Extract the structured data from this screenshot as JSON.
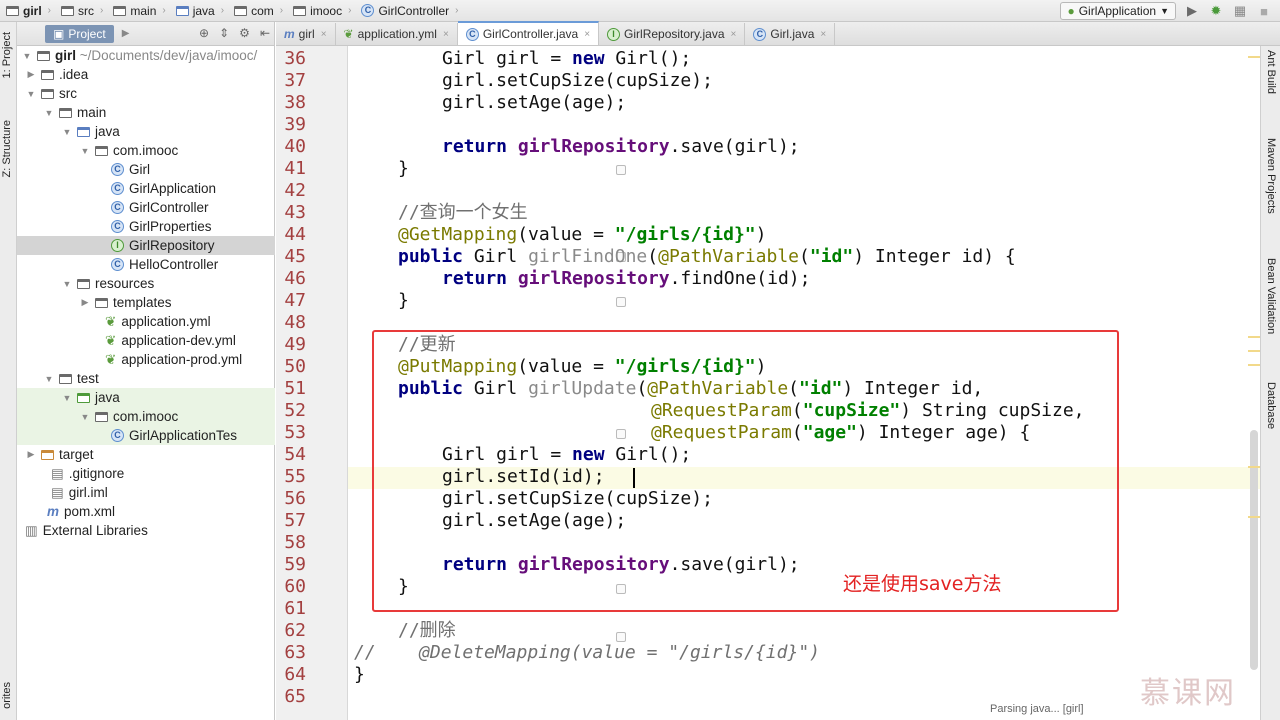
{
  "breadcrumb": [
    "girl",
    "src",
    "main",
    "java",
    "com",
    "imooc",
    "GirlController"
  ],
  "run_config": "GirlApplication",
  "left_tabs": [
    "1: Project",
    "Z: Structure",
    "orites"
  ],
  "right_tabs": [
    "Ant Build",
    "Maven Projects",
    "Bean Validation",
    "Database"
  ],
  "project_panel": {
    "title": "Project",
    "root_label": "girl",
    "root_path": "~/Documents/dev/java/imooc/",
    "tree": [
      {
        "label": ".idea"
      },
      {
        "label": "src"
      },
      {
        "label": "main"
      },
      {
        "label": "java"
      },
      {
        "label": "com.imooc"
      },
      {
        "label": "Girl"
      },
      {
        "label": "GirlApplication"
      },
      {
        "label": "GirlController"
      },
      {
        "label": "GirlProperties"
      },
      {
        "label": "GirlRepository"
      },
      {
        "label": "HelloController"
      },
      {
        "label": "resources"
      },
      {
        "label": "templates"
      },
      {
        "label": "application.yml"
      },
      {
        "label": "application-dev.yml"
      },
      {
        "label": "application-prod.yml"
      },
      {
        "label": "test"
      },
      {
        "label": "java"
      },
      {
        "label": "com.imooc"
      },
      {
        "label": "GirlApplicationTes"
      },
      {
        "label": "target"
      },
      {
        "label": ".gitignore"
      },
      {
        "label": "girl.iml"
      },
      {
        "label": "pom.xml"
      },
      {
        "label": "External Libraries"
      }
    ]
  },
  "tabs": [
    "girl",
    "application.yml",
    "GirlController.java",
    "GirlRepository.java",
    "Girl.java"
  ],
  "active_tab": "GirlController.java",
  "line_numbers": [
    "36",
    "37",
    "38",
    "39",
    "40",
    "41",
    "42",
    "43",
    "44",
    "45",
    "46",
    "47",
    "48",
    "49",
    "50",
    "51",
    "52",
    "53",
    "54",
    "55",
    "56",
    "57",
    "58",
    "59",
    "60",
    "61",
    "62",
    "63",
    "64",
    "65"
  ],
  "code": {
    "l36": {
      "a": "Girl girl = ",
      "b": "new",
      "c": " Girl();"
    },
    "l37": "girl.setCupSize(cupSize);",
    "l38": "girl.setAge(age);",
    "l40": {
      "kw": "return",
      "f": "girlRepository",
      "rest": ".save(girl);"
    },
    "l41": "}",
    "l43": "//查询一个女生",
    "l44": {
      "an": "@GetMapping",
      "p1": "(value = ",
      "s": "\"/girls/{id}\"",
      "p2": ")"
    },
    "l45": {
      "kw": "public",
      "t": " Girl ",
      "m": "girlFindOne",
      "p": "(",
      "an": "@PathVariable",
      "p2": "(",
      "s": "\"id\"",
      "rest": ") Integer id) {"
    },
    "l46": {
      "kw": "return",
      "f": "girlRepository",
      "rest": ".findOne(id);"
    },
    "l47": "}",
    "l49": "//更新",
    "l50": {
      "an": "@PutMapping",
      "p1": "(value = ",
      "s": "\"/girls/{id}\"",
      "p2": ")"
    },
    "l51": {
      "kw": "public",
      "t": " Girl ",
      "m": "girlUpdate",
      "p": "(",
      "an": "@PathVariable",
      "p2": "(",
      "s": "\"id\"",
      "rest": ") Integer id,"
    },
    "l52": {
      "an": "@RequestParam",
      "p": "(",
      "s": "\"cupSize\"",
      "rest": ") String cupSize,"
    },
    "l53": {
      "an": "@RequestParam",
      "p": "(",
      "s": "\"age\"",
      "rest": ") Integer age) {"
    },
    "l54": {
      "a": "Girl girl = ",
      "b": "new",
      "c": " Girl();"
    },
    "l55": "girl.setId(id);",
    "l56": "girl.setCupSize(cupSize);",
    "l57": "girl.setAge(age);",
    "l59": {
      "kw": "return",
      "f": "girlRepository",
      "rest": ".save(girl);"
    },
    "l60": "}",
    "l62": "//删除",
    "l63": "//    @DeleteMapping(value = \"/girls/{id}\")",
    "l64": "}"
  },
  "annotation_note": "还是使用save方法",
  "status_text": "Parsing java... [girl]",
  "watermark": "慕课网",
  "colors": {
    "highlight_box": "#e83a3a",
    "note": "#e32222",
    "keyword": "#000080",
    "string": "#008000",
    "field": "#660e7a",
    "annotation": "#7a7a00"
  }
}
